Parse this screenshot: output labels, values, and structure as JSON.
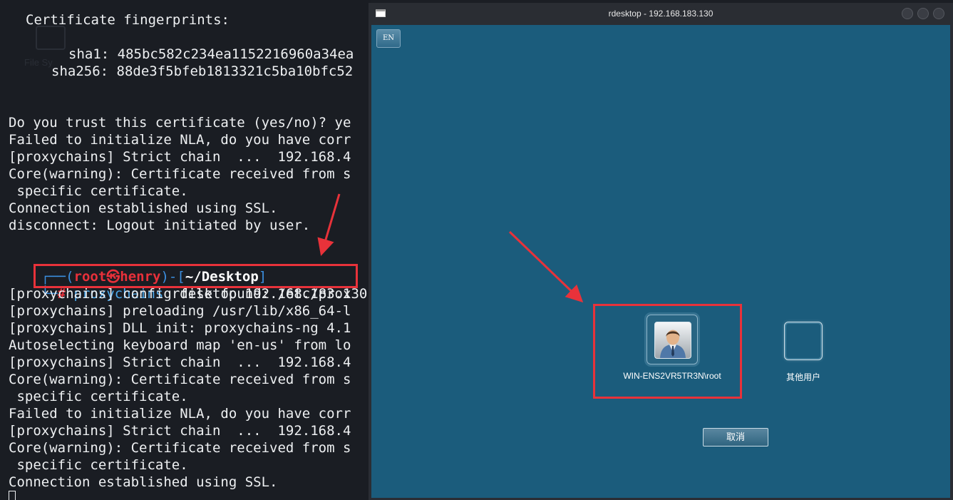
{
  "terminal": {
    "cert_header": "Certificate fingerprints:",
    "sha1": "sha1: 485bc582c234ea1152216960a34ea",
    "sha256": "sha256: 88de3f5bfeb1813321c5ba10bfc52",
    "before": [
      "Do you trust this certificate (yes/no)? ye",
      "Failed to initialize NLA, do you have corr",
      "[proxychains] Strict chain  ...  192.168.4",
      "Core(warning): Certificate received from s",
      " specific certificate.",
      "Connection established using SSL.",
      "disconnect: Logout initiated by user."
    ],
    "prompt": {
      "open": "┌──(",
      "user": "root㉿henry",
      "mid": ")-[",
      "path": "~/Desktop",
      "close": "]",
      "corner": "└─",
      "hash": "# ",
      "cmd_tool": "proxychains",
      "cmd_args": " rdesktop 192.168.183.130"
    },
    "after": [
      "[proxychains] config file found: /etc/prox",
      "[proxychains] preloading /usr/lib/x86_64-l",
      "[proxychains] DLL init: proxychains-ng 4.1",
      "Autoselecting keyboard map 'en-us' from lo",
      "[proxychains] Strict chain  ...  192.168.4",
      "Core(warning): Certificate received from s",
      " specific certificate.",
      "Failed to initialize NLA, do you have corr",
      "[proxychains] Strict chain  ...  192.168.4",
      "Core(warning): Certificate received from s",
      " specific certificate.",
      "Connection established using SSL."
    ],
    "ghost_label": "File Sy"
  },
  "rdp": {
    "title": "rdesktop - 192.168.183.130",
    "lang": "EN",
    "user_name": "WIN-ENS2VR5TR3N\\root",
    "other_user": "其他用户",
    "cancel": "取消"
  },
  "colors": {
    "terminal_bg": "#1a1d23",
    "desktop_bg": "#1b5c7c",
    "highlight": "#e8323a"
  }
}
